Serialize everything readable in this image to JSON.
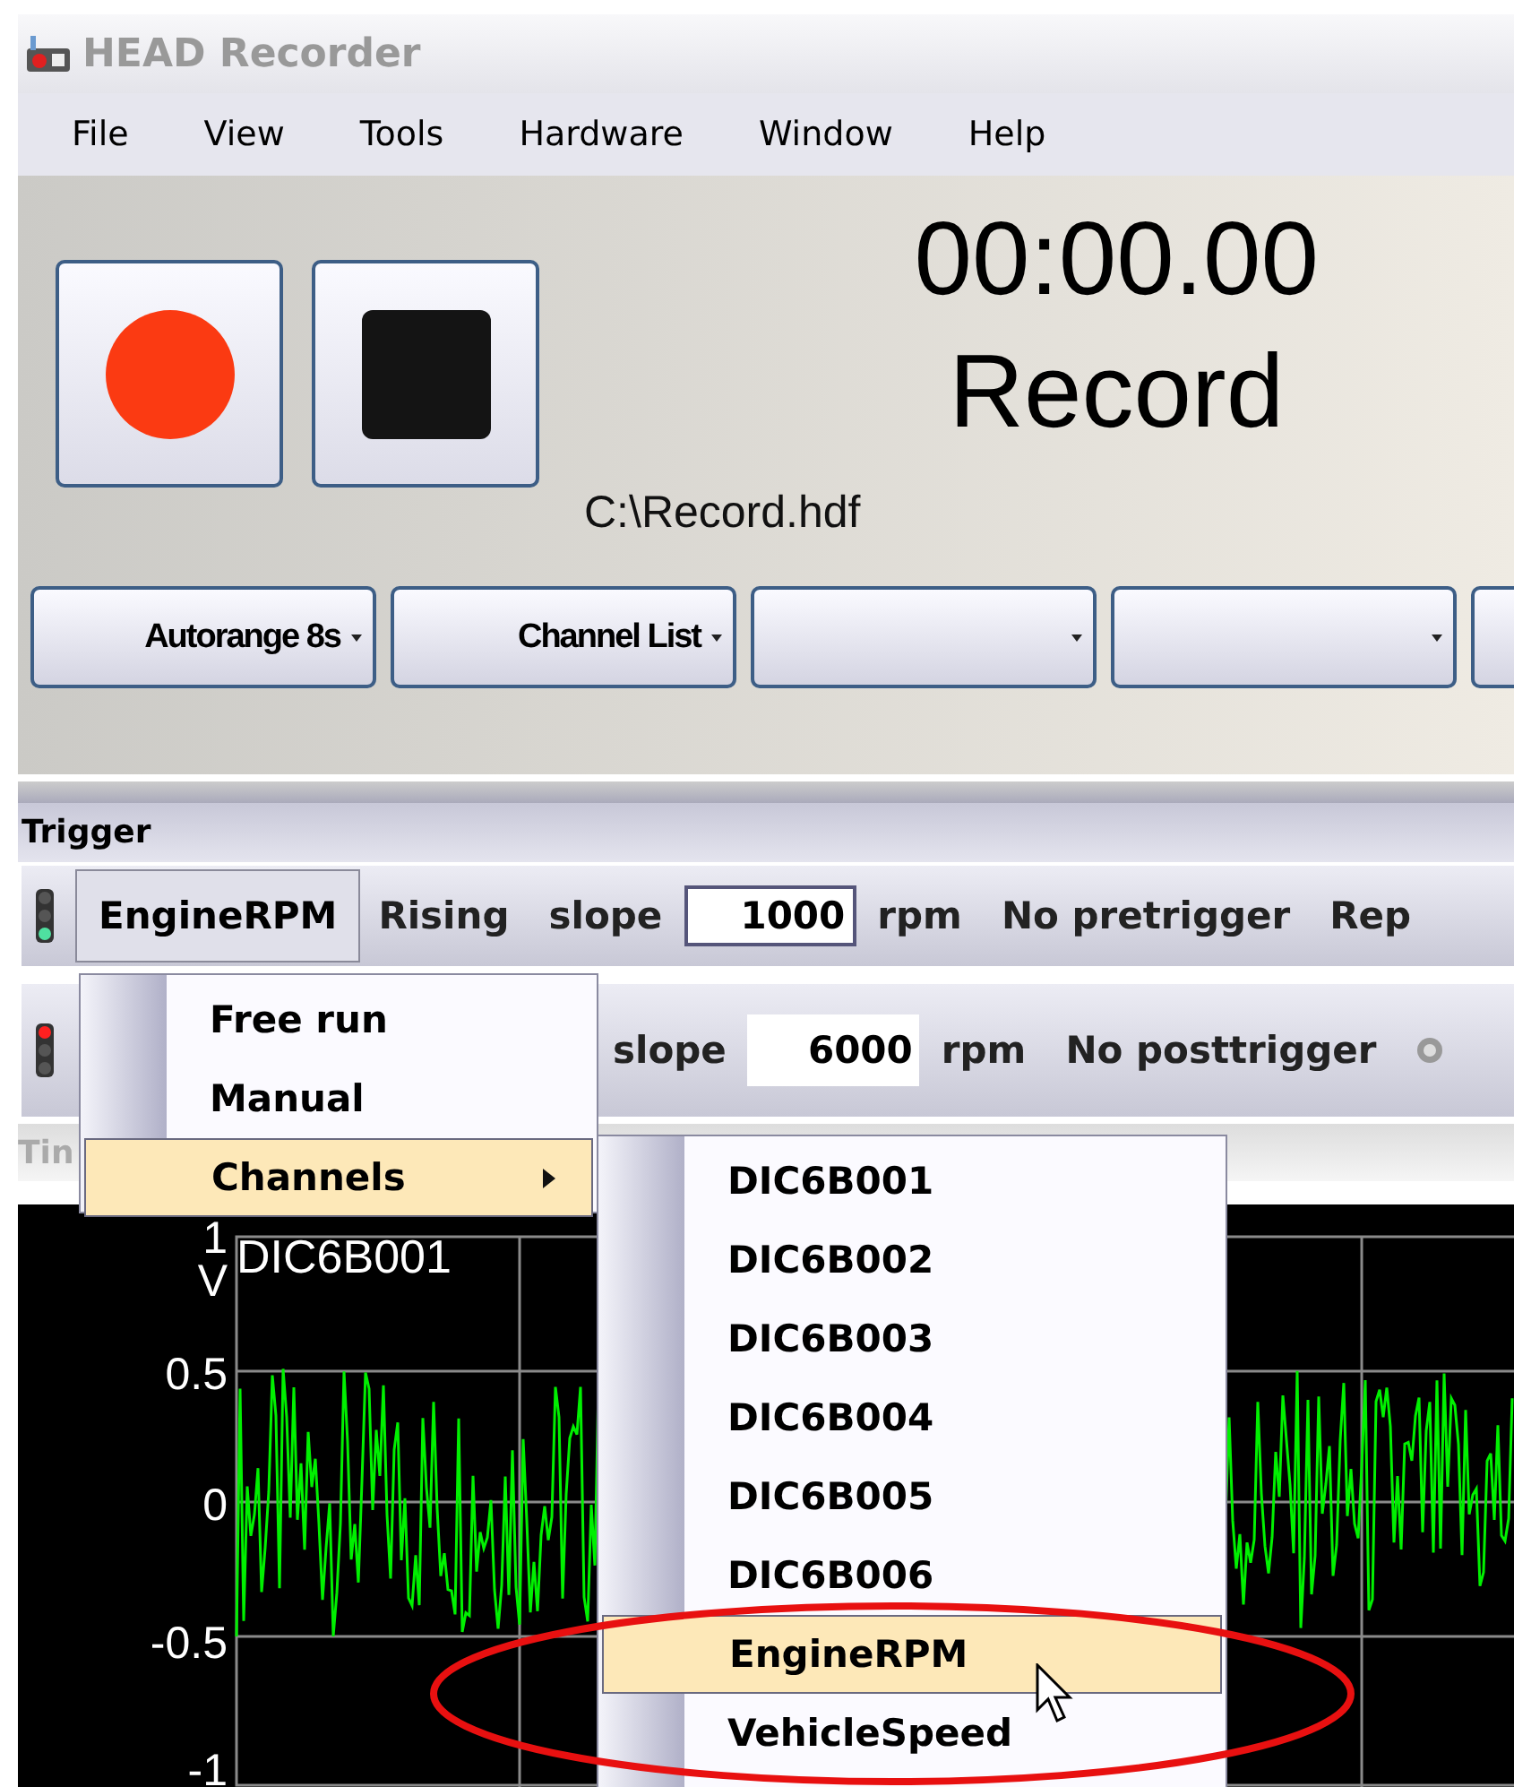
{
  "window": {
    "title": "HEAD Recorder"
  },
  "menu_bar": [
    "File",
    "View",
    "Tools",
    "Hardware",
    "Window",
    "Help"
  ],
  "recorder": {
    "file_path": "C:\\Record.hdf",
    "timer": "00:00.00",
    "status": "Record"
  },
  "dropdowns": [
    {
      "kind": "labeled",
      "label": "Autorange 8s"
    },
    {
      "kind": "labeled",
      "label": "Channel List"
    },
    {
      "kind": "blank"
    },
    {
      "kind": "blank"
    },
    {
      "kind": "blank"
    }
  ],
  "trigger": {
    "title": "Trigger",
    "rows": [
      {
        "color": "#4fe0a0",
        "channel": "EngineRPM",
        "edge": "Rising",
        "slope_label": "slope",
        "value": "1000",
        "unit": "rpm",
        "mode": "No pretrigger",
        "extra": "Rep",
        "kind": "start"
      },
      {
        "color": "#ff2020",
        "slope_label": "slope",
        "value": "6000",
        "unit": "rpm",
        "mode": "No posttrigger",
        "kind": "stop"
      }
    ]
  },
  "plot_header": {
    "label": "Tin"
  },
  "plot": {
    "channel": "DIC6B001",
    "y_labels": [
      "1",
      "V",
      "0.5",
      "0",
      "-0.5",
      "-1"
    ]
  },
  "trigger_menu": {
    "items": [
      {
        "label": "Free run",
        "selected": false,
        "submenu": false
      },
      {
        "label": "Manual",
        "selected": false,
        "submenu": false
      },
      {
        "label": "Channels",
        "selected": true,
        "submenu": true
      }
    ]
  },
  "channels_menu": {
    "items": [
      {
        "label": "DIC6B001",
        "selected": false
      },
      {
        "label": "DIC6B002",
        "selected": false
      },
      {
        "label": "DIC6B003",
        "selected": false
      },
      {
        "label": "DIC6B004",
        "selected": false
      },
      {
        "label": "DIC6B005",
        "selected": false
      },
      {
        "label": "DIC6B006",
        "selected": false
      },
      {
        "label": "EngineRPM",
        "selected": true
      },
      {
        "label": "VehicleSpeed",
        "selected": false
      }
    ]
  }
}
